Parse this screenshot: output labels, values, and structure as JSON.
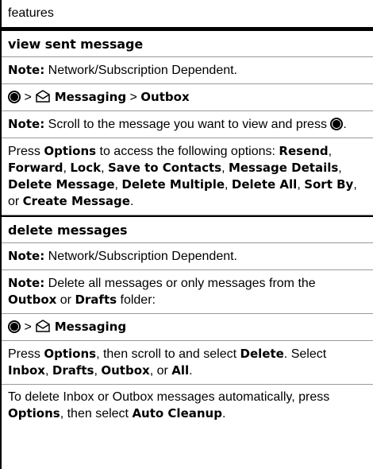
{
  "header": {
    "title": "features"
  },
  "section1": {
    "title": "view sent message",
    "note1": {
      "label": "Note:",
      "text": " Network/Subscription Dependent."
    },
    "nav": {
      "sep1": " > ",
      "messaging": "Messaging",
      "sep2": " > ",
      "outbox": "Outbox"
    },
    "note2": {
      "label": "Note:",
      "text": " Scroll to the message you want to view and press "
    },
    "para": {
      "t1": "Press ",
      "options": "Options",
      "t2": " to access the following options: ",
      "items": [
        "Resend",
        "Forward",
        "Lock",
        "Save to Contacts",
        "Message Details",
        "Delete Message",
        "Delete Multiple",
        "Delete All",
        "Sort By",
        "Create Message"
      ],
      "sep": ", ",
      "or": ", or ",
      "end": "."
    }
  },
  "section2": {
    "title": "delete messages",
    "note1": {
      "label": "Note:",
      "text": " Network/Subscription Dependent."
    },
    "note2": {
      "label": "Note:",
      "t1": " Delete all messages or only messages from the ",
      "outbox": "Outbox",
      "t2": " or ",
      "drafts": "Drafts",
      "t3": " folder:"
    },
    "nav": {
      "sep1": " > ",
      "messaging": "Messaging"
    },
    "para1": {
      "t1": "Press ",
      "options": "Options",
      "t2": ", then scroll to and select ",
      "delete": "Delete",
      "t3": ". Select ",
      "inbox": "Inbox",
      "c1": ", ",
      "drafts": "Drafts",
      "c2": ", ",
      "outbox": "Outbox",
      "c3": ", or ",
      "all": "All",
      "end": "."
    },
    "para2": {
      "t1": "To delete Inbox or Outbox messages automatically, press ",
      "options": "Options",
      "t2": ", then select ",
      "auto": "Auto Cleanup",
      "end": "."
    }
  },
  "icons": {
    "center_key": "center-select-key-icon",
    "messaging": "messaging-envelope-icon"
  }
}
